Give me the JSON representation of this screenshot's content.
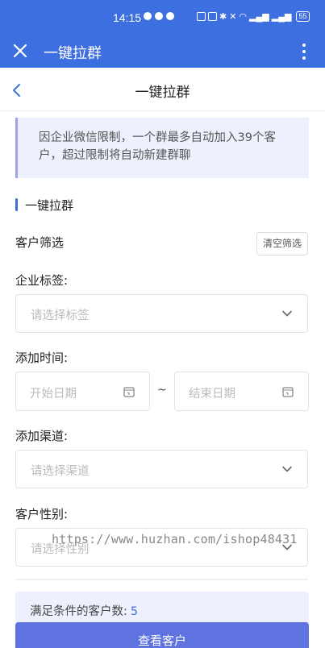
{
  "status_bar": {
    "time": "14:15",
    "battery": "55"
  },
  "app_header": {
    "title": "一键拉群"
  },
  "page": {
    "title": "一键拉群"
  },
  "notice": {
    "text": "因企业微信限制，一个群最多自动加入39个客户，超过限制将自动新建群聊"
  },
  "section": {
    "title": "一键拉群"
  },
  "filter": {
    "label": "客户筛选",
    "clear_label": "清空筛选"
  },
  "fields": {
    "tag": {
      "label": "企业标签:",
      "placeholder": "请选择标签"
    },
    "time": {
      "label": "添加时间:",
      "start_placeholder": "开始日期",
      "end_placeholder": "结束日期",
      "separator": "~"
    },
    "channel": {
      "label": "添加渠道:",
      "placeholder": "请选择渠道"
    },
    "gender": {
      "label": "客户性别:",
      "placeholder": "请选择性别"
    }
  },
  "watermark": "https://www.huzhan.com/ishop48431",
  "result": {
    "label": "满足条件的客户数:",
    "count": "5"
  },
  "view_button": {
    "label": "查看客户"
  },
  "colors": {
    "primary": "#3e6fe0",
    "button": "#5e72e0",
    "notice_bg": "#eef1fd"
  }
}
